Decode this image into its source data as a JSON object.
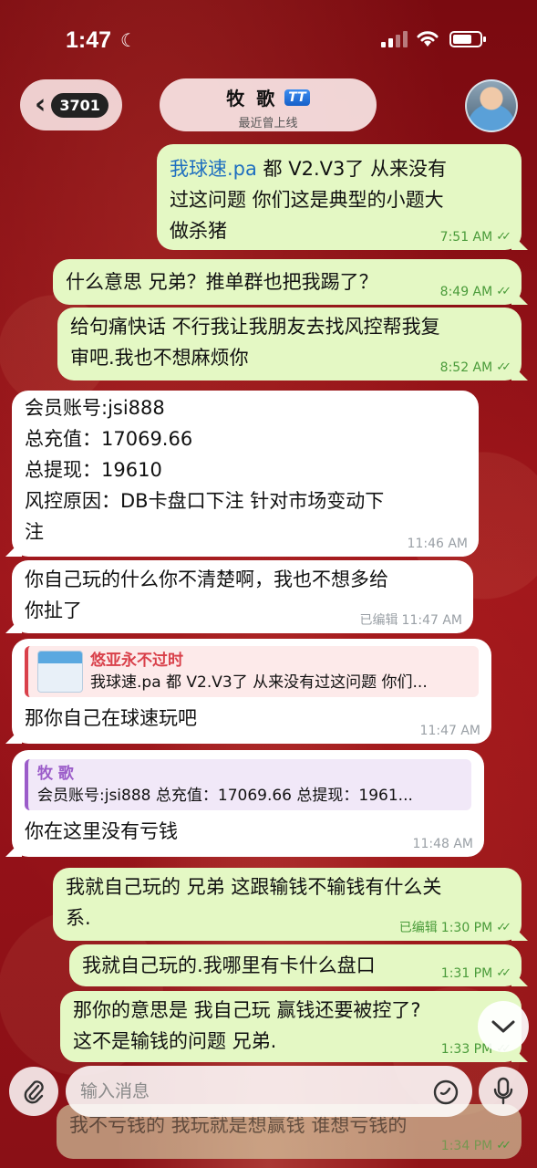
{
  "status_bar": {
    "time": "1:47"
  },
  "header": {
    "back_count": "3701",
    "contact_name": "牧 歌",
    "verified_badge": "TT",
    "last_seen": "最近曾上线"
  },
  "messages": [
    {
      "dir": "out",
      "link": "我球速.pa",
      "text_line1": " 都 V2.V3了 从来没有",
      "text_line2": "过这问题 你们这是典型的小题大",
      "text_line3": "做杀猪",
      "time": "7:51 AM"
    },
    {
      "dir": "out",
      "text": "什么意思 兄弟？推单群也把我踢了？",
      "time": "8:49 AM"
    },
    {
      "dir": "out",
      "text_line1": "给句痛快话 不行我让我朋友去找风控帮我复",
      "text_line2": "审吧.我也不想麻烦你",
      "time": "8:52 AM"
    },
    {
      "dir": "in",
      "line1": "会员账号:jsi888",
      "line2": "总充值：17069.66",
      "line3": "总提现：19610",
      "line4": "风控原因：DB卡盘口下注  针对市场变动下",
      "line5": "注",
      "time": "11:46 AM"
    },
    {
      "dir": "in",
      "text_line1": "你自己玩的什么你不清楚啊，我也不想多给",
      "text_line2": "你扯了",
      "edited": "已编辑",
      "time": "11:47 AM"
    },
    {
      "dir": "in",
      "quote_name": "悠亚永不过时",
      "quote_text": "我球速.pa 都 V2.V3了 从来没有过这问题 你们...",
      "text": "那你自己在球速玩吧",
      "time": "11:47 AM"
    },
    {
      "dir": "in",
      "quote_name": "牧 歌",
      "quote_text": "会员账号:jsi888 总充值：17069.66 总提现：1961...",
      "text": "你在这里没有亏钱",
      "time": "11:48 AM"
    },
    {
      "dir": "out",
      "text_line1": "我就自己玩的 兄弟 这跟输钱不输钱有什么关",
      "text_line2": "系.",
      "edited": "已编辑",
      "time": "1:30 PM"
    },
    {
      "dir": "out",
      "text": "我就自己玩的.我哪里有卡什么盘口",
      "time": "1:31 PM"
    },
    {
      "dir": "out",
      "text_line1": "那你的意思是 我自己玩 赢钱还要被控了?",
      "text_line2": "这不是输钱的问题 兄弟.",
      "time": "1:33 PM"
    },
    {
      "dir": "out",
      "text": "我不亏钱的 我玩就是想赢钱 谁想亏钱的",
      "time": "1:34 PM"
    }
  ],
  "composer": {
    "placeholder": "输入消息"
  },
  "colors": {
    "outgoing": "#e4f8c4",
    "incoming": "#ffffff",
    "accent_green": "#4a9b3a",
    "link": "#1f6fc0"
  }
}
